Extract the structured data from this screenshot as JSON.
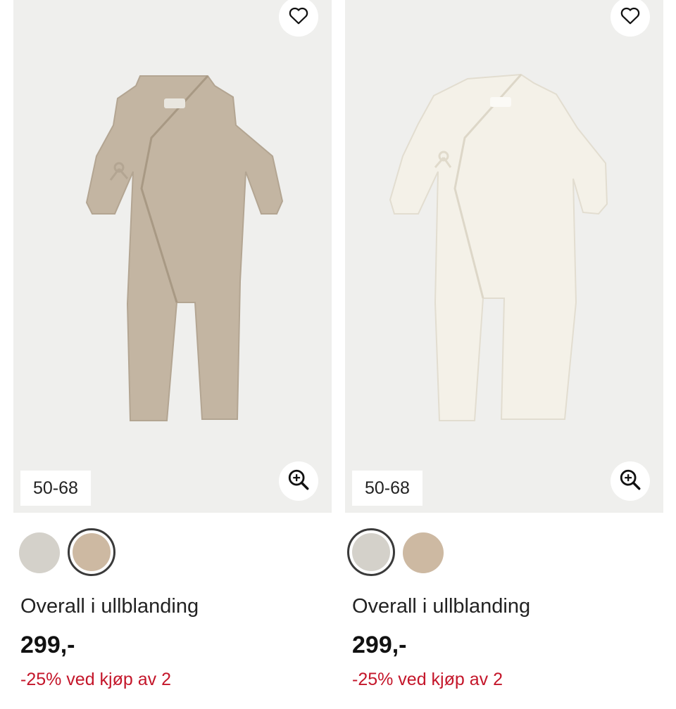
{
  "products": [
    {
      "size_label": "50-68",
      "title": "Overall i ullblanding",
      "price": "299,-",
      "promo": "-25% ved kjøp av 2",
      "garment_color": "#c3b5a2",
      "swatches": [
        {
          "color": "#d4d1ca",
          "selected": false
        },
        {
          "color": "#cdb9a2",
          "selected": true
        }
      ]
    },
    {
      "size_label": "50-68",
      "title": "Overall i ullblanding",
      "price": "299,-",
      "promo": "-25% ved kjøp av 2",
      "garment_color": "#f4f1e8",
      "swatches": [
        {
          "color": "#d4d1ca",
          "selected": true
        },
        {
          "color": "#cdb9a2",
          "selected": false
        }
      ]
    }
  ],
  "colors": {
    "image_background": "#efefed",
    "promo": "#c4162a"
  },
  "icons": {
    "favorite": "heart-icon",
    "zoom": "zoom-in-icon"
  }
}
